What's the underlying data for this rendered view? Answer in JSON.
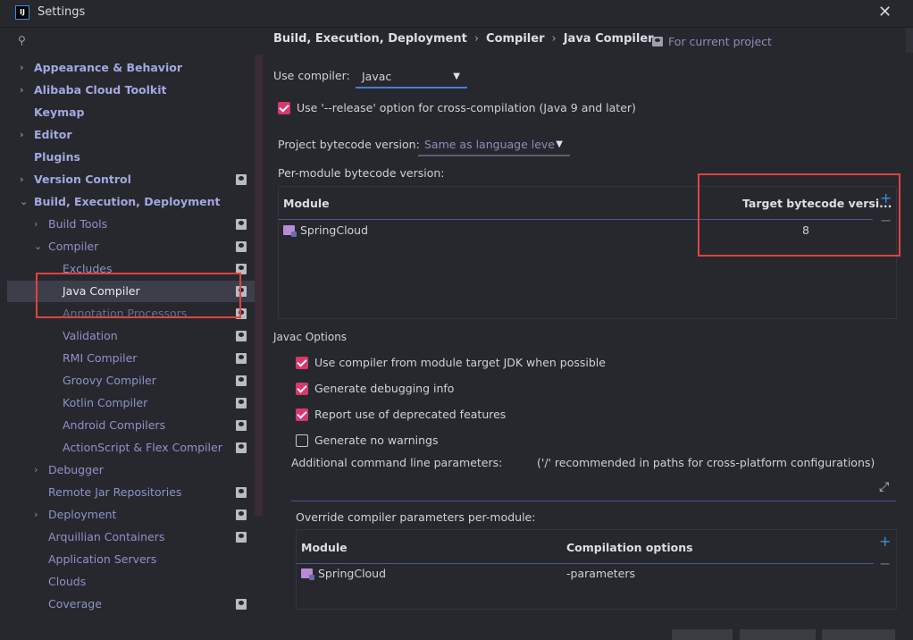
{
  "window": {
    "title": "Settings",
    "app_icon": "IJ"
  },
  "search": {
    "placeholder": ""
  },
  "sidebar": {
    "items": [
      {
        "label": "Appearance & Behavior",
        "arrow": "›"
      },
      {
        "label": "Alibaba Cloud Toolkit",
        "arrow": "›"
      },
      {
        "label": "Keymap"
      },
      {
        "label": "Editor",
        "arrow": "›"
      },
      {
        "label": "Plugins"
      },
      {
        "label": "Version Control",
        "arrow": "›"
      },
      {
        "label": "Build, Execution, Deployment",
        "arrow": "⌄"
      },
      {
        "label": "Build Tools",
        "arrow": "›"
      },
      {
        "label": "Compiler",
        "arrow": "⌄"
      },
      {
        "label": "Excludes"
      },
      {
        "label": "Java Compiler"
      },
      {
        "label": "Annotation Processors"
      },
      {
        "label": "Validation"
      },
      {
        "label": "RMI Compiler"
      },
      {
        "label": "Groovy Compiler"
      },
      {
        "label": "Kotlin Compiler"
      },
      {
        "label": "Android Compilers"
      },
      {
        "label": "ActionScript & Flex Compiler"
      },
      {
        "label": "Debugger",
        "arrow": "›"
      },
      {
        "label": "Remote Jar Repositories"
      },
      {
        "label": "Deployment",
        "arrow": "›"
      },
      {
        "label": "Arquillian Containers"
      },
      {
        "label": "Application Servers"
      },
      {
        "label": "Clouds"
      },
      {
        "label": "Coverage"
      }
    ]
  },
  "breadcrumb": {
    "parts": [
      "Build, Execution, Deployment",
      "Compiler",
      "Java Compiler"
    ],
    "separator": "›",
    "for_project": "For current project"
  },
  "compiler": {
    "use_compiler_label": "Use compiler:",
    "use_compiler_value": "Javac",
    "release_option_label": "Use '--release' option for cross-compilation (Java 9 and later)",
    "release_option_checked": true,
    "bytecode_label": "Project bytecode version:",
    "bytecode_value": "Same as language leve",
    "per_module_label": "Per-module bytecode version:",
    "module_table": {
      "headers": [
        "Module",
        "Target bytecode versi..."
      ],
      "rows": [
        {
          "module": "SpringCloud",
          "target": "8"
        }
      ]
    }
  },
  "javac": {
    "section_title": "Javac Options",
    "options": [
      {
        "label": "Use compiler from module target JDK when possible",
        "checked": true
      },
      {
        "label": "Generate debugging info",
        "checked": true
      },
      {
        "label": "Report use of deprecated features",
        "checked": true
      },
      {
        "label": "Generate no warnings",
        "checked": false
      }
    ],
    "additional_params_label": "Additional command line parameters:",
    "additional_params_hint": "('/' recommended in paths for cross-platform configurations)",
    "override_label": "Override compiler parameters per-module:",
    "override_table": {
      "headers": [
        "Module",
        "Compilation options"
      ],
      "rows": [
        {
          "module": "SpringCloud",
          "options": "-parameters"
        }
      ]
    }
  },
  "icons": {
    "plus": "+",
    "minus": "−",
    "dropdown": "▼",
    "close": "✕",
    "expand": "⤢",
    "search": "⚲"
  },
  "colors": {
    "accent_checkbox": "#d8386d",
    "highlight_red": "#e0433e",
    "link_blue": "#3e8ed8"
  }
}
